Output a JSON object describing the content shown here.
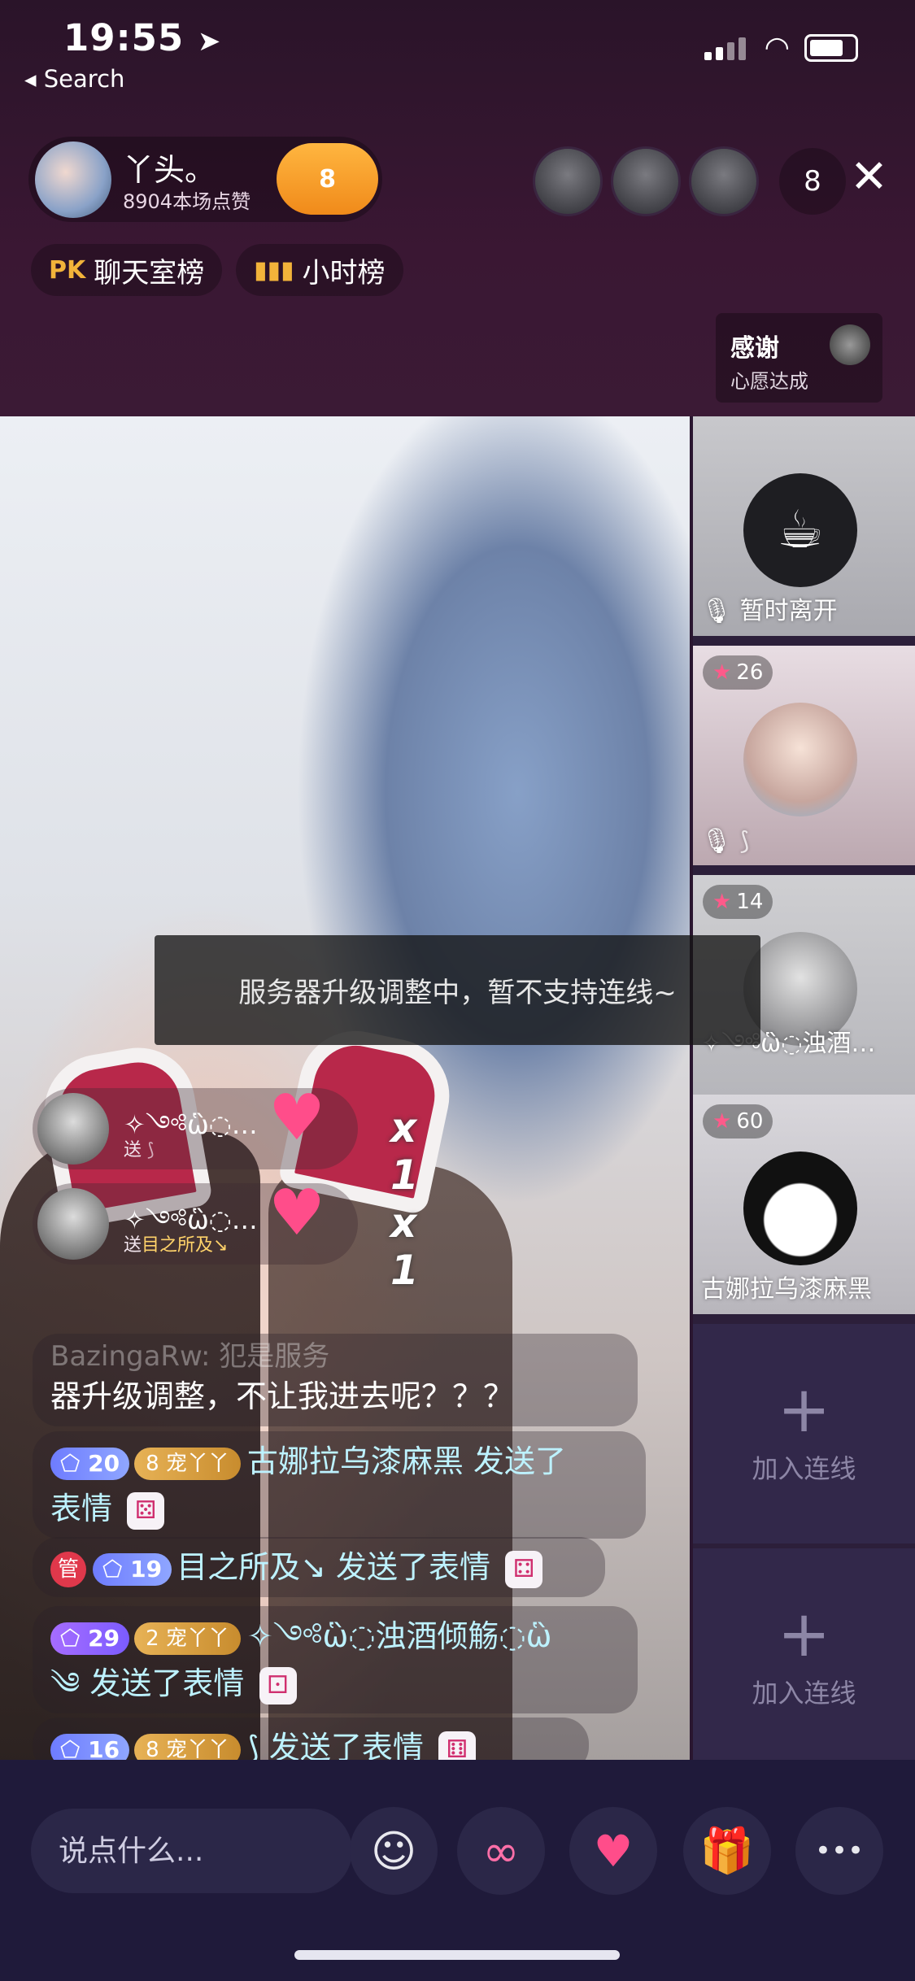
{
  "status_bar": {
    "time": "19:55",
    "nav_arrow": "➤",
    "back_label": "◂ Search"
  },
  "host": {
    "name": "丫头。",
    "likes": "8904本场点赞",
    "level": "8"
  },
  "viewers": {
    "count": "8",
    "close_icon": "✕"
  },
  "ranks": {
    "chat_rank_label": "聊天室榜",
    "hour_rank_label": "小时榜"
  },
  "thanks": {
    "title": "感谢",
    "subtitle": "心愿达成"
  },
  "seats": [
    {
      "status": "暂时离开"
    },
    {
      "badge": "26"
    },
    {
      "badge": "14",
      "name": "✧༺ὣ◌浊酒…"
    },
    {
      "badge": "60",
      "name": "古娜拉乌漆麻黑"
    }
  ],
  "join_seats": [
    {
      "label": "加入连线"
    },
    {
      "label": "加入连线"
    }
  ],
  "toast": "服务器升级调整中，暂不支持连线~",
  "gifts": [
    {
      "sender": "✧༺ὣ◌…",
      "sub_prefix": "送",
      "sub_target": "",
      "count": "x 1"
    },
    {
      "sender": "✧༺ὣ◌…",
      "sub_prefix": "送",
      "sub_target": "目之所及↘",
      "count": "x 1"
    }
  ],
  "chat": {
    "faded_line1": "BazingaRw: 犯是服务",
    "line1_text": "器升级调整，不让我进去呢？？？",
    "line2": {
      "level": "20",
      "pet": "宠丫丫",
      "pet_level": "8",
      "nick": "古娜拉乌漆麻黑",
      "msg": "发送了",
      "msg2": "表情"
    },
    "line3": {
      "mgr": "管",
      "level": "19",
      "nick": "目之所及↘",
      "msg": "发送了表情"
    },
    "line4": {
      "level": "29",
      "pet": "宠丫丫",
      "pet_level": "2",
      "nick": "✧༺ὣ◌浊酒倾觞◌ὣ",
      "nick2": "༄",
      "msg": "发送了表情"
    },
    "line5": {
      "level": "16",
      "pet": "宠丫丫",
      "pet_level": "8",
      "nick": "⟆",
      "msg": "发送了表情"
    }
  },
  "bottom": {
    "input_placeholder": "说点什么...",
    "emoji_icon": "☺",
    "link_icon": "∞",
    "heart_icon": "♥",
    "gift_icon": "🎁",
    "more_icon": "•••"
  }
}
